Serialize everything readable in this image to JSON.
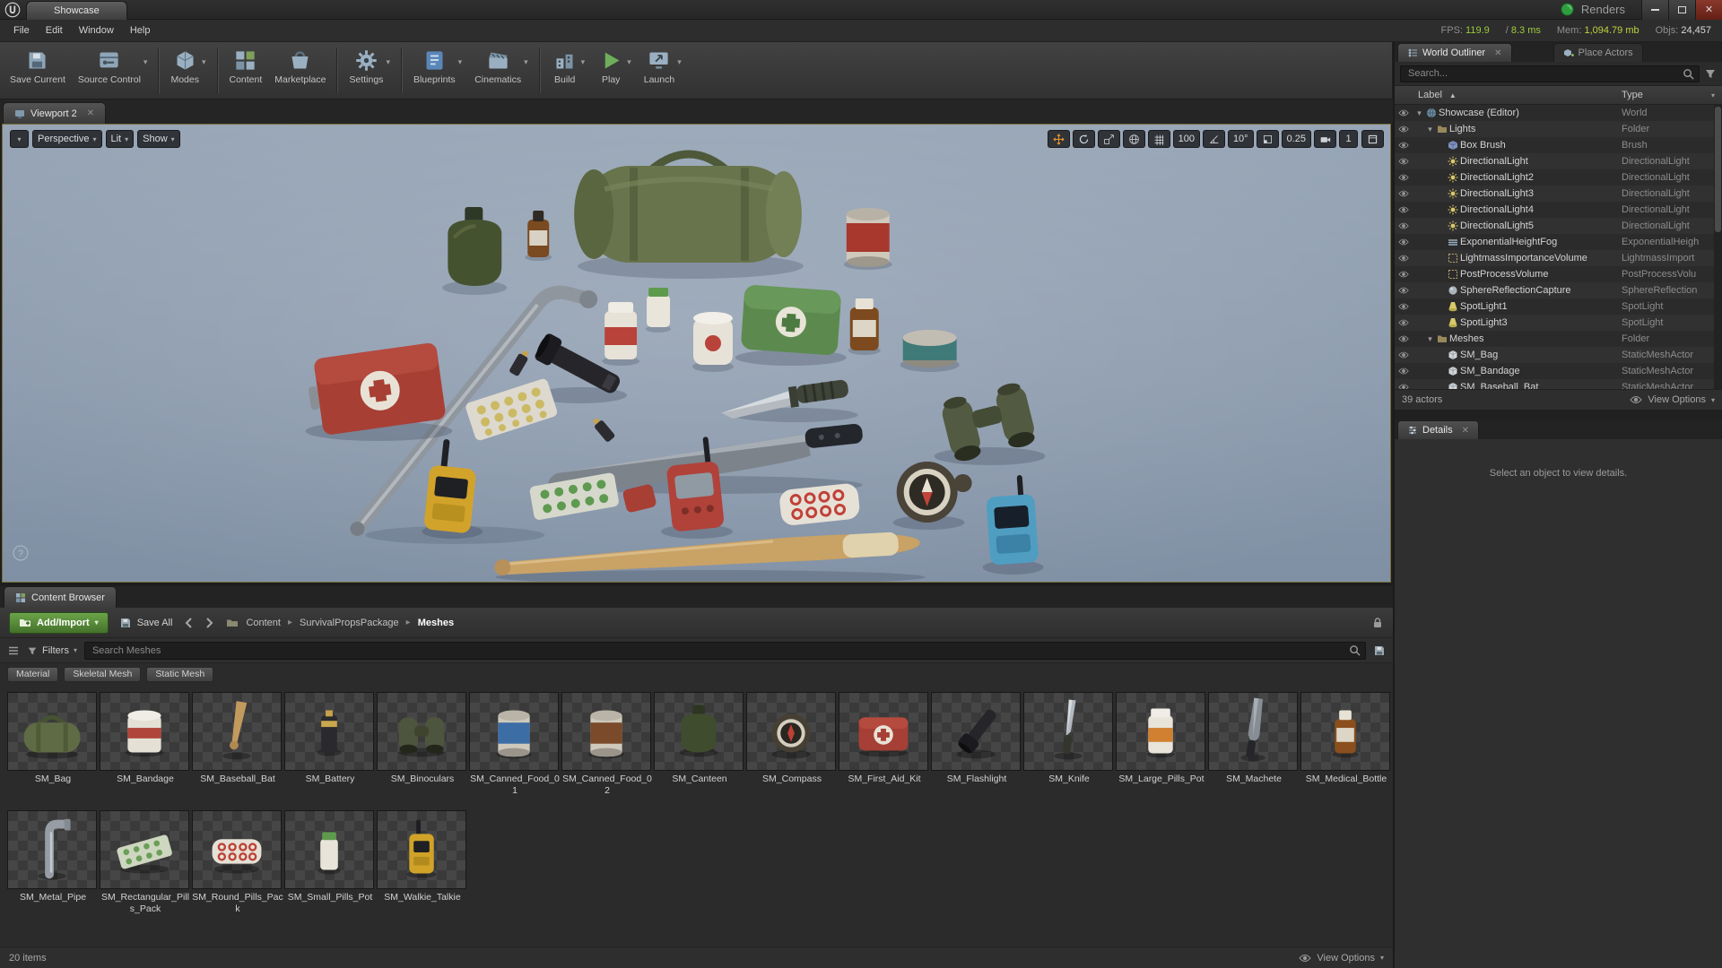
{
  "titlebar": {
    "tab": "Showcase",
    "project": "Renders",
    "stats": [
      {
        "id": "fps",
        "label": "FPS:",
        "value": "119.9",
        "value_color": "#9ccb3c"
      },
      {
        "id": "ms",
        "label": "/",
        "value": "8.3 ms",
        "value_color": "#9ccb3c"
      },
      {
        "id": "mem",
        "label": "Mem:",
        "value": "1,094.79 mb",
        "value_color": "#bfd23c"
      },
      {
        "id": "objs",
        "label": "Objs:",
        "value": "24,457",
        "value_color": "#d8d8d8"
      }
    ]
  },
  "menubar": {
    "items": [
      "File",
      "Edit",
      "Window",
      "Help"
    ]
  },
  "toolbar": {
    "buttons": [
      {
        "label": "Save Current",
        "icon": "save-icon",
        "dropdown": false
      },
      {
        "label": "Source Control",
        "icon": "source-control-icon",
        "dropdown": true
      },
      {
        "label": "Modes",
        "icon": "modes-icon",
        "dropdown": true,
        "new_group": true
      },
      {
        "label": "Content",
        "icon": "content-icon",
        "dropdown": false,
        "new_group": true
      },
      {
        "label": "Marketplace",
        "icon": "marketplace-icon",
        "dropdown": false
      },
      {
        "label": "Settings",
        "icon": "settings-icon",
        "dropdown": true,
        "new_group": true
      },
      {
        "label": "Blueprints",
        "icon": "blueprints-icon",
        "dropdown": true,
        "new_group": true
      },
      {
        "label": "Cinematics",
        "icon": "cinematics-icon",
        "dropdown": true
      },
      {
        "label": "Build",
        "icon": "build-icon",
        "dropdown": true,
        "new_group": true
      },
      {
        "label": "Play",
        "icon": "play-icon",
        "dropdown": true
      },
      {
        "label": "Launch",
        "icon": "launch-icon",
        "dropdown": true
      }
    ]
  },
  "viewport": {
    "tab": "Viewport 2",
    "perspective": "Perspective",
    "lit": "Lit",
    "show": "Show",
    "grid_snap": "100",
    "rotation_snap": "10°",
    "scale_snap": "0.25",
    "camera_speed": "1"
  },
  "outliner": {
    "tab": "World Outliner",
    "place_actors_tab": "Place Actors",
    "search_placeholder": "Search...",
    "col_label": "Label",
    "col_type": "Type",
    "rows": [
      {
        "label": "Showcase (Editor)",
        "type": "World",
        "indent": 0,
        "icon": "world-icon",
        "expanded": true
      },
      {
        "label": "Lights",
        "type": "Folder",
        "indent": 1,
        "icon": "folder-icon",
        "expanded": true
      },
      {
        "label": "Box Brush",
        "type": "Brush",
        "indent": 2,
        "icon": "brush-icon"
      },
      {
        "label": "DirectionalLight",
        "type": "DirectionalLight",
        "indent": 2,
        "icon": "dirlight-icon"
      },
      {
        "label": "DirectionalLight2",
        "type": "DirectionalLight",
        "indent": 2,
        "icon": "dirlight-icon"
      },
      {
        "label": "DirectionalLight3",
        "type": "DirectionalLight",
        "indent": 2,
        "icon": "dirlight-icon"
      },
      {
        "label": "DirectionalLight4",
        "type": "DirectionalLight",
        "indent": 2,
        "icon": "dirlight-icon"
      },
      {
        "label": "DirectionalLight5",
        "type": "DirectionalLight",
        "indent": 2,
        "icon": "dirlight-icon"
      },
      {
        "label": "ExponentialHeightFog",
        "type": "ExponentialHeigh",
        "indent": 2,
        "icon": "fog-icon"
      },
      {
        "label": "LightmassImportanceVolume",
        "type": "LightmassImport",
        "indent": 2,
        "icon": "volume-icon"
      },
      {
        "label": "PostProcessVolume",
        "type": "PostProcessVolu",
        "indent": 2,
        "icon": "volume-icon"
      },
      {
        "label": "SphereReflectionCapture",
        "type": "SphereReflection",
        "indent": 2,
        "icon": "sphere-icon"
      },
      {
        "label": "SpotLight1",
        "type": "SpotLight",
        "indent": 2,
        "icon": "spotlight-icon"
      },
      {
        "label": "SpotLight3",
        "type": "SpotLight",
        "indent": 2,
        "icon": "spotlight-icon"
      },
      {
        "label": "Meshes",
        "type": "Folder",
        "indent": 1,
        "icon": "folder-icon",
        "expanded": true
      },
      {
        "label": "SM_Bag",
        "type": "StaticMeshActor",
        "indent": 2,
        "icon": "mesh-icon"
      },
      {
        "label": "SM_Bandage",
        "type": "StaticMeshActor",
        "indent": 2,
        "icon": "mesh-icon"
      },
      {
        "label": "SM_Baseball_Bat",
        "type": "StaticMeshActor",
        "indent": 2,
        "icon": "mesh-icon"
      }
    ],
    "footer_count": "39 actors",
    "view_options": "View Options"
  },
  "details": {
    "tab": "Details",
    "empty_message": "Select an object to view details."
  },
  "content_browser": {
    "tab": "Content Browser",
    "add_import": "Add/Import",
    "save_all": "Save All",
    "breadcrumb": [
      "Content",
      "SurvivalPropsPackage",
      "Meshes"
    ],
    "filters": "Filters",
    "search_placeholder": "Search Meshes",
    "chips": [
      "Material",
      "Skeletal Mesh",
      "Static Mesh"
    ],
    "assets": [
      {
        "name": "SM_Bag",
        "icon": "bag"
      },
      {
        "name": "SM_Bandage",
        "icon": "bandage"
      },
      {
        "name": "SM_Baseball_Bat",
        "icon": "baseball-bat"
      },
      {
        "name": "SM_Battery",
        "icon": "battery"
      },
      {
        "name": "SM_Binoculars",
        "icon": "binoculars"
      },
      {
        "name": "SM_Canned_Food_01",
        "icon": "canned-food-1"
      },
      {
        "name": "SM_Canned_Food_02",
        "icon": "canned-food-2"
      },
      {
        "name": "SM_Canteen",
        "icon": "canteen"
      },
      {
        "name": "SM_Compass",
        "icon": "compass"
      },
      {
        "name": "SM_First_Aid_Kit",
        "icon": "first-aid-kit"
      },
      {
        "name": "SM_Flashlight",
        "icon": "flashlight"
      },
      {
        "name": "SM_Knife",
        "icon": "knife"
      },
      {
        "name": "SM_Large_Pills_Pot",
        "icon": "large-pills-pot"
      },
      {
        "name": "SM_Machete",
        "icon": "machete"
      },
      {
        "name": "SM_Medical_Bottle",
        "icon": "medical-bottle"
      },
      {
        "name": "SM_Metal_Pipe",
        "icon": "metal-pipe"
      },
      {
        "name": "SM_Rectangular_Pills_Pack",
        "icon": "rectangular-pills-pack"
      },
      {
        "name": "SM_Round_Pills_Pack",
        "icon": "round-pills-pack"
      },
      {
        "name": "SM_Small_Pills_Pot",
        "icon": "small-pills-pot"
      },
      {
        "name": "SM_Walkie_Talkie",
        "icon": "walkie-talkie"
      }
    ],
    "footer_count": "20 items",
    "view_options": "View Options"
  },
  "colors": {
    "accent_green": "#4c8b3c",
    "viewport_bg": "#8b9aad",
    "active_tool_orange": "#e8952f",
    "viewport_border": "#756e3a"
  }
}
